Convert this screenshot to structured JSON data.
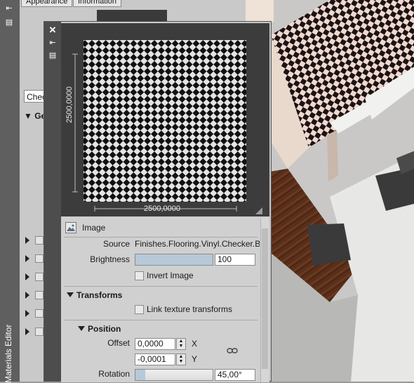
{
  "left_strip": {
    "title": "Materials Editor"
  },
  "bg_editor": {
    "tabs": [
      "Appearance",
      "Information"
    ],
    "search_value": "Chec",
    "section_label": "Ge"
  },
  "texture_editor": {
    "close_glyph": "✕",
    "dim_width": "2500,0000",
    "dim_height": "2500,0000",
    "image_label": "Image",
    "source_label": "Source",
    "source_value": "Finishes.Flooring.Vinyl.Checker.B",
    "brightness_label": "Brightness",
    "brightness_value": "100",
    "brightness_level": 1.0,
    "invert_label": "Invert Image",
    "invert_checked": false,
    "transforms_label": "Transforms",
    "link_label": "Link texture transforms",
    "link_checked": false,
    "position_label": "Position",
    "offset_label": "Offset",
    "offset_x": "0,0000",
    "offset_y": "-0,0001",
    "axis_x": "X",
    "axis_y": "Y",
    "rotation_label": "Rotation",
    "rotation_value": "45,00°",
    "rotation_level": 0.125
  },
  "icons": [
    "collapse-icon",
    "panel-icon",
    "close-icon",
    "image-icon",
    "link-chain-icon",
    "resize-grip-icon"
  ]
}
